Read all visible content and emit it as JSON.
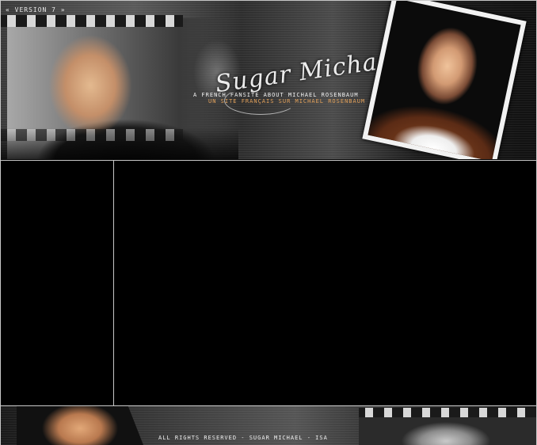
{
  "header": {
    "version_label": "« VERSION 7 »",
    "site_title": "Sugar Michael",
    "tagline_en": "A FRENCH FANSITE ABOUT MICHAEL ROSENBAUM",
    "tagline_fr": "UN SITE FRANÇAIS SUR MICHAEL ROSENBAUM"
  },
  "footer": {
    "copyright": "ALL RIGHTS RESERVED - SUGAR MICHAEL - ISA"
  }
}
